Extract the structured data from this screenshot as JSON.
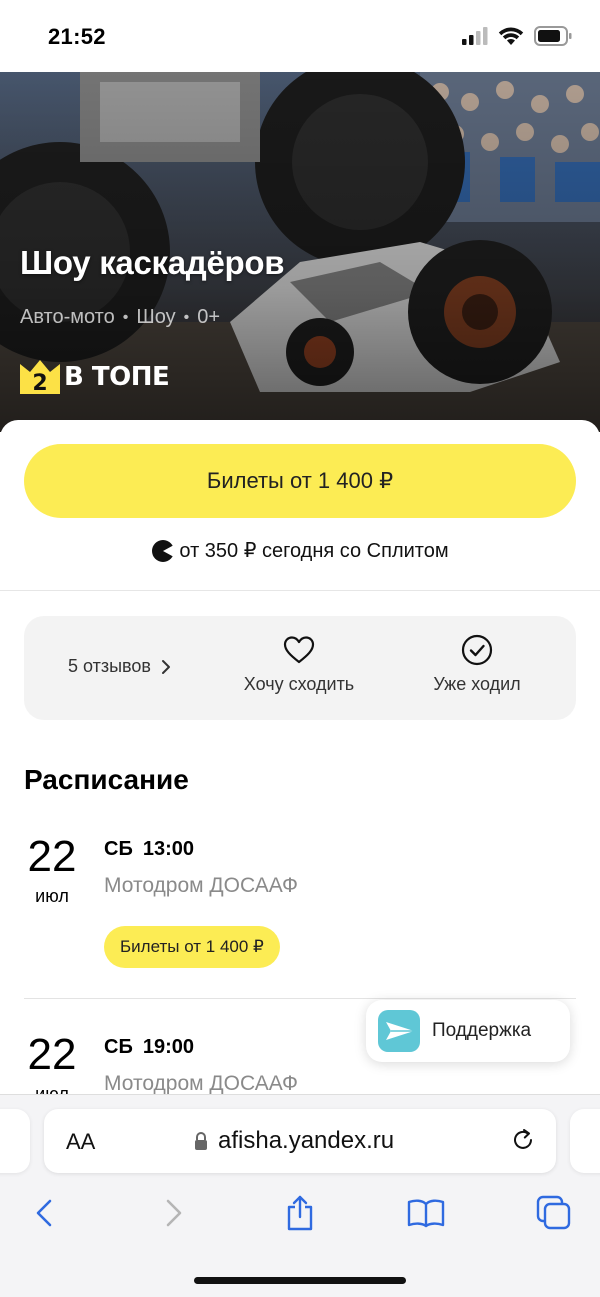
{
  "status_bar": {
    "time": "21:52"
  },
  "hero": {
    "title": "Шоу каскадёров",
    "meta": [
      "Авто-мото",
      "Шоу",
      "0+"
    ],
    "badge_number": "2",
    "badge_text": "В ТОПЕ"
  },
  "tickets_button": "Билеты от 1 400 ₽",
  "split_text": "от 350 ₽ сегодня со Сплитом",
  "actions": {
    "reviews": "5 отзывов",
    "want": "Хочу сходить",
    "been": "Уже ходил"
  },
  "schedule": {
    "title": "Расписание",
    "events": [
      {
        "day": "22",
        "month": "июл",
        "weekday": "СБ",
        "time": "13:00",
        "place": "Мотодром ДОСААФ",
        "button": "Билеты от 1 400 ₽"
      },
      {
        "day": "22",
        "month": "июл",
        "weekday": "СБ",
        "time": "19:00",
        "place": "Мотодром ДОСААФ"
      }
    ]
  },
  "support": {
    "label": "Поддержка"
  },
  "browser": {
    "aa": "AA",
    "url": "afisha.yandex.ru"
  },
  "colors": {
    "accent": "#fcec54",
    "support_icon": "#5fc7d6"
  }
}
